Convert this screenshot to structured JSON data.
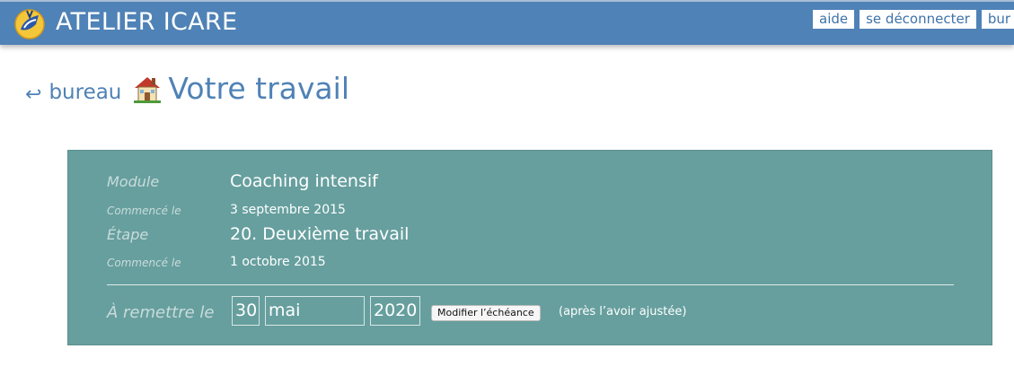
{
  "header": {
    "brand": "ATELIER ICARE",
    "links": [
      "aide",
      "se déconnecter",
      "bur"
    ]
  },
  "title_row": {
    "back_arrow": "↩",
    "back_label": "bureau",
    "title": "Votre travail"
  },
  "panel": {
    "module_label": "Module",
    "module_value": "Coaching intensif",
    "module_started_label": "Commencé le",
    "module_started_value": "3 septembre 2015",
    "step_label": "Étape",
    "step_value": "20. Deuxième travail",
    "step_started_label": "Commencé le",
    "step_started_value": "1 octobre 2015",
    "due_label": "À remettre le",
    "due_day": "30",
    "due_month": "mai",
    "due_year": "2020",
    "modify_button": "Modifier l’échéance",
    "note": "(après l’avoir ajustée)"
  },
  "colors": {
    "header_bg": "#4f82b6",
    "panel_bg": "#669f9e",
    "link_color": "#4f82b6"
  },
  "icons": [
    "icare-logo",
    "return-arrow-icon",
    "house-icon"
  ]
}
